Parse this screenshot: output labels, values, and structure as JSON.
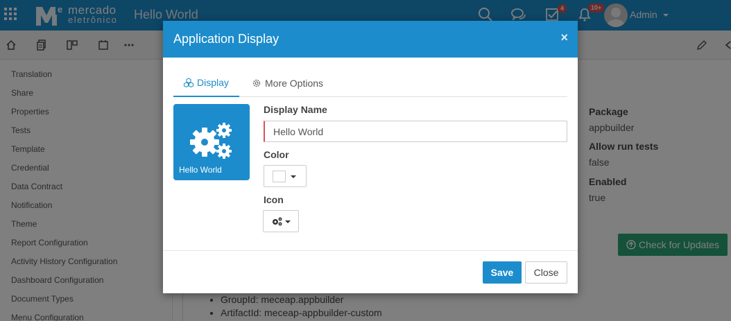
{
  "header": {
    "logo_line1": "mercado",
    "logo_line2": "eletrônico",
    "app_title": "Hello World",
    "tasks_badge": "4",
    "notifications_badge": "10+",
    "user_name": "Admin"
  },
  "sidebar": {
    "items": [
      {
        "label": "Translation"
      },
      {
        "label": "Share"
      },
      {
        "label": "Properties"
      },
      {
        "label": "Tests"
      },
      {
        "label": "Template"
      },
      {
        "label": "Credential"
      },
      {
        "label": "Data Contract"
      },
      {
        "label": "Notification"
      },
      {
        "label": "Theme"
      },
      {
        "label": "Report Configuration"
      },
      {
        "label": "Activity History Configuration"
      },
      {
        "label": "Dashboard Configuration"
      },
      {
        "label": "Document Types"
      },
      {
        "label": "Menu Configuration"
      }
    ]
  },
  "details": {
    "package_label": "Package",
    "package_value": "appbuilder",
    "run_tests_label": "Allow run tests",
    "run_tests_value": "false",
    "enabled_label": "Enabled",
    "enabled_value": "true",
    "check_updates_label": "Check for Updates",
    "group_id": "GroupId: meceap.appbuilder",
    "artifact_id": "ArtifactId: meceap-appbuilder-custom"
  },
  "modal": {
    "title": "Application Display",
    "close_glyph": "×",
    "tabs": [
      {
        "label": "Display"
      },
      {
        "label": "More Options"
      }
    ],
    "preview_label": "Hello World",
    "display_name_label": "Display Name",
    "display_name_value": "Hello World",
    "color_label": "Color",
    "color_value": "#ffffff",
    "icon_label": "Icon",
    "icon_name": "cogs-icon",
    "save_label": "Save",
    "close_label": "Close"
  },
  "colors": {
    "primary": "#1c8ccc",
    "success": "#2ba572",
    "danger": "#d9534f"
  }
}
